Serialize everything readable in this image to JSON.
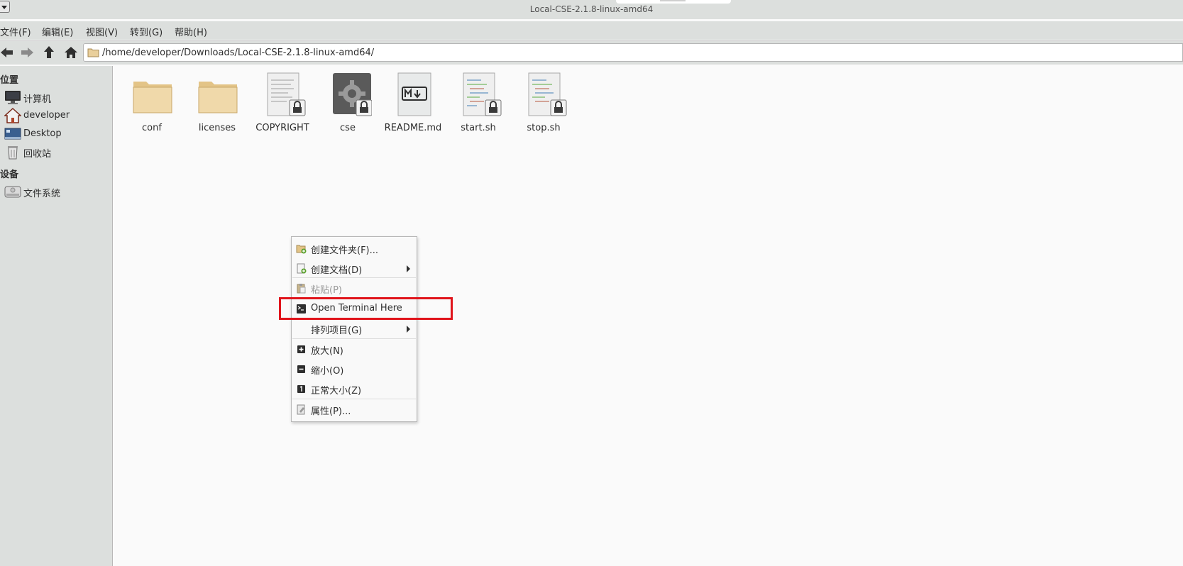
{
  "window": {
    "title": "Local-CSE-2.1.8-linux-amd64"
  },
  "menubar": {
    "items": [
      "文件(F)",
      "编辑(E)",
      "视图(V)",
      "转到(G)",
      "帮助(H)"
    ]
  },
  "toolbar": {
    "back_icon": "arrow-left-icon",
    "forward_icon": "arrow-right-icon",
    "up_icon": "arrow-up-icon",
    "home_icon": "home-icon",
    "address": "/home/developer/Downloads/Local-CSE-2.1.8-linux-amd64/"
  },
  "sidebar": {
    "places_heading": "位置",
    "places": [
      {
        "label": "计算机",
        "icon": "computer-icon"
      },
      {
        "label": "developer",
        "icon": "home-icon"
      },
      {
        "label": "Desktop",
        "icon": "desktop-icon"
      },
      {
        "label": "回收站",
        "icon": "trash-icon"
      }
    ],
    "devices_heading": "设备",
    "devices": [
      {
        "label": "文件系统",
        "icon": "drive-icon"
      }
    ]
  },
  "files": [
    {
      "name": "conf",
      "type": "folder"
    },
    {
      "name": "licenses",
      "type": "folder"
    },
    {
      "name": "COPYRIGHT",
      "type": "text-locked"
    },
    {
      "name": "cse",
      "type": "executable-locked"
    },
    {
      "name": "README.md",
      "type": "markdown"
    },
    {
      "name": "start.sh",
      "type": "script-locked"
    },
    {
      "name": "stop.sh",
      "type": "script-locked"
    }
  ],
  "context_menu": {
    "items": [
      {
        "label": "创建文件夹(F)...",
        "icon": "new-folder-icon",
        "submenu": false,
        "disabled": false
      },
      {
        "label": "创建文档(D)",
        "icon": "new-document-icon",
        "submenu": true,
        "disabled": false
      },
      {
        "label": "粘贴(P)",
        "icon": "paste-icon",
        "submenu": false,
        "disabled": true
      },
      {
        "label": "Open Terminal Here",
        "icon": "terminal-icon",
        "submenu": false,
        "disabled": false
      },
      {
        "label": "排列项目(G)",
        "icon": "",
        "submenu": true,
        "disabled": false
      },
      {
        "label": "放大(N)",
        "icon": "zoom-in-icon",
        "submenu": false,
        "disabled": false
      },
      {
        "label": "缩小(O)",
        "icon": "zoom-out-icon",
        "submenu": false,
        "disabled": false
      },
      {
        "label": "正常大小(Z)",
        "icon": "zoom-reset-icon",
        "submenu": false,
        "disabled": false
      },
      {
        "label": "属性(P)...",
        "icon": "properties-icon",
        "submenu": false,
        "disabled": false
      }
    ]
  },
  "colors": {
    "chrome": "#dcdfdd",
    "background": "#fafafa",
    "highlight": "#e0141b",
    "folder": "#e9cf9b"
  }
}
